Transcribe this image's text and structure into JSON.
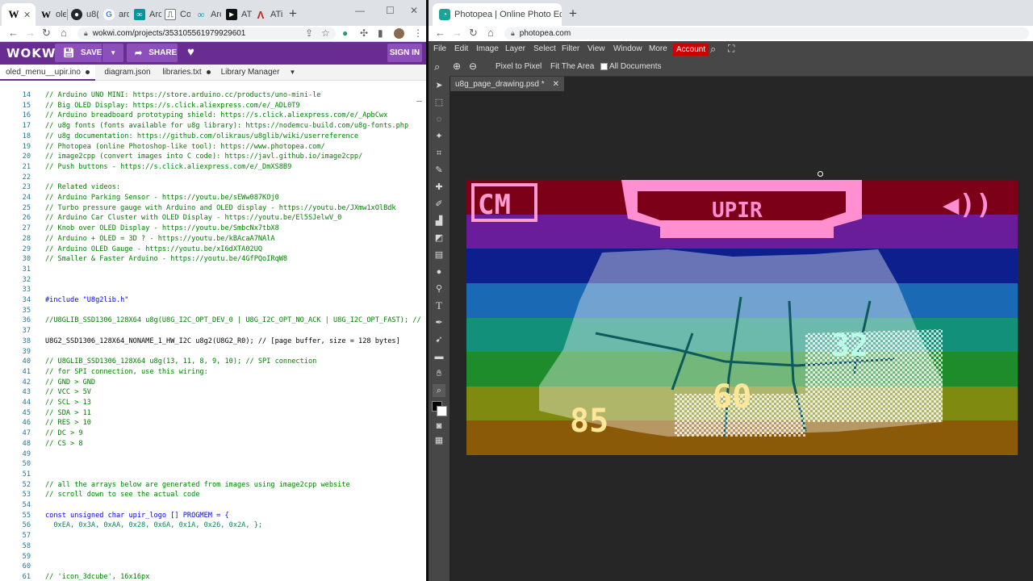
{
  "left_browser": {
    "tabs": [
      {
        "label": "",
        "favicon": "W",
        "favicon_color": "#000000"
      },
      {
        "label": "ole",
        "favicon": "W",
        "favicon_color": "#000000"
      },
      {
        "label": "u8(",
        "favicon": "github",
        "favicon_color": "#24292e"
      },
      {
        "label": "ard",
        "favicon": "G",
        "favicon_color": "#4285f4"
      },
      {
        "label": "Arc",
        "favicon": "arc",
        "favicon_color": "#00979c"
      },
      {
        "label": "Co",
        "favicon": "co",
        "favicon_color": "#777777"
      },
      {
        "label": "Arc",
        "favicon": "oo",
        "favicon_color": "#00979c"
      },
      {
        "label": "ATi",
        "favicon": "ati",
        "favicon_color": "#111111"
      },
      {
        "label": "ATi",
        "favicon": "A",
        "favicon_color": "#cc2222"
      }
    ],
    "url": "wokwi.com/projects/353105561979929601"
  },
  "wokwi": {
    "logo": "WOKWi",
    "save_label": "SAVE",
    "share_label": "SHARE",
    "sign_in_label": "SIGN IN",
    "file_tabs": [
      {
        "label": "oled_menu__upir.ino",
        "modified": true
      },
      {
        "label": "diagram.json",
        "modified": false
      },
      {
        "label": "libraries.txt",
        "modified": true
      },
      {
        "label": "Library Manager",
        "modified": false
      }
    ]
  },
  "code": [
    {
      "n": "14",
      "text": "// Arduino UNO MINI: https://store.arduino.cc/products/uno-mini-le"
    },
    {
      "n": "15",
      "text": "// Big OLED Display: https://s.click.aliexpress.com/e/_ADL0T9"
    },
    {
      "n": "16",
      "text": "// Arduino breadboard prototyping shield: https://s.click.aliexpress.com/e/_ApbCwx"
    },
    {
      "n": "17",
      "text": "// u8g fonts (fonts available for u8g library): https://nodemcu-build.com/u8g-fonts.php"
    },
    {
      "n": "18",
      "text": "// u8g documentation: https://github.com/olikraus/u8glib/wiki/userreference"
    },
    {
      "n": "19",
      "text": "// Photopea (online Photoshop-like tool): https://www.photopea.com/"
    },
    {
      "n": "20",
      "text": "// image2cpp (convert images into C code): https://javl.github.io/image2cpp/"
    },
    {
      "n": "21",
      "text": "// Push buttons - https://s.click.aliexpress.com/e/_DmXS8B9"
    },
    {
      "n": "22",
      "text": ""
    },
    {
      "n": "23",
      "text": "// Related videos:"
    },
    {
      "n": "24",
      "text": "// Arduino Parking Sensor - https://youtu.be/sEWw087KOj0"
    },
    {
      "n": "25",
      "text": "// Turbo pressure gauge with Arduino and OLED display - https://youtu.be/JXmw1xOlBdk"
    },
    {
      "n": "26",
      "text": "// Arduino Car Cluster with OLED Display - https://youtu.be/El5SJelwV_0"
    },
    {
      "n": "27",
      "text": "// Knob over OLED Display - https://youtu.be/SmbcNx7tbX8"
    },
    {
      "n": "28",
      "text": "// Arduino + OLED = 3D ? - https://youtu.be/kBAcaA7NAlA"
    },
    {
      "n": "29",
      "text": "// Arduino OLED Gauge - https://youtu.be/xI6dXTA02UQ"
    },
    {
      "n": "30",
      "text": "// Smaller & Faster Arduino - https://youtu.be/4GfPQoIRqW8"
    },
    {
      "n": "31",
      "text": ""
    },
    {
      "n": "32",
      "text": ""
    },
    {
      "n": "33",
      "text": ""
    },
    {
      "n": "34",
      "text": "#include \"U8g2lib.h\""
    },
    {
      "n": "35",
      "text": ""
    },
    {
      "n": "36",
      "text": "//U8GLIB_SSD1306_128X64 u8g(U8G_I2C_OPT_DEV_0 | U8G_I2C_OPT_NO_ACK | U8G_I2C_OPT_FAST); //"
    },
    {
      "n": "37",
      "text": ""
    },
    {
      "n": "38",
      "text": "U8G2_SSD1306_128X64_NONAME_1_HW_I2C u8g2(U8G2_R0); // [page buffer, size = 128 bytes]"
    },
    {
      "n": "39",
      "text": ""
    },
    {
      "n": "40",
      "text": "// U8GLIB_SSD1306_128X64 u8g(13, 11, 8, 9, 10); // SPI connection"
    },
    {
      "n": "41",
      "text": "// for SPI connection, use this wiring:"
    },
    {
      "n": "42",
      "text": "// GND > GND"
    },
    {
      "n": "43",
      "text": "// VCC > 5V"
    },
    {
      "n": "44",
      "text": "// SCL > 13"
    },
    {
      "n": "45",
      "text": "// SDA > 11"
    },
    {
      "n": "46",
      "text": "// RES > 10"
    },
    {
      "n": "47",
      "text": "// DC > 9"
    },
    {
      "n": "48",
      "text": "// CS > 8"
    },
    {
      "n": "49",
      "text": ""
    },
    {
      "n": "50",
      "text": ""
    },
    {
      "n": "51",
      "text": ""
    },
    {
      "n": "52",
      "text": "// all the arrays below are generated from images using image2cpp website"
    },
    {
      "n": "53",
      "text": "// scroll down to see the actual code"
    },
    {
      "n": "54",
      "text": ""
    },
    {
      "n": "55",
      "text": "const unsigned char upir_logo [] PROGMEM = {"
    },
    {
      "n": "56",
      "text": "  0xEA, 0x3A, 0xAA, 0x28, 0x6A, 0x1A, 0x26, 0x2A, };"
    },
    {
      "n": "57",
      "text": ""
    },
    {
      "n": "58",
      "text": ""
    },
    {
      "n": "59",
      "text": ""
    },
    {
      "n": "60",
      "text": ""
    },
    {
      "n": "61",
      "text": "// 'icon_3dcube', 16x16px"
    }
  ],
  "right_browser": {
    "tab_title": "Photopea | Online Photo Editor",
    "url": "photopea.com"
  },
  "photopea": {
    "menu": [
      "File",
      "Edit",
      "Image",
      "Layer",
      "Select",
      "Filter",
      "View",
      "Window",
      "More"
    ],
    "account_label": "Account",
    "options": {
      "pixel_to_pixel": "Pixel to Pixel",
      "fit_the_area": "Fit The Area",
      "all_documents": "All Documents"
    },
    "doc_tab": "u8g_page_drawing.psd *",
    "canvas_text": {
      "logo_left": "CM",
      "logo_center": "UPIR",
      "gauge_left": "85",
      "gauge_center": "60",
      "gauge_right": "32"
    },
    "bands": [
      "#7b0018",
      "#6a1d9a",
      "#0d1f8c",
      "#1a69b4",
      "#12907a",
      "#1e8c2a",
      "#7f8a10",
      "#8a5a08"
    ]
  }
}
